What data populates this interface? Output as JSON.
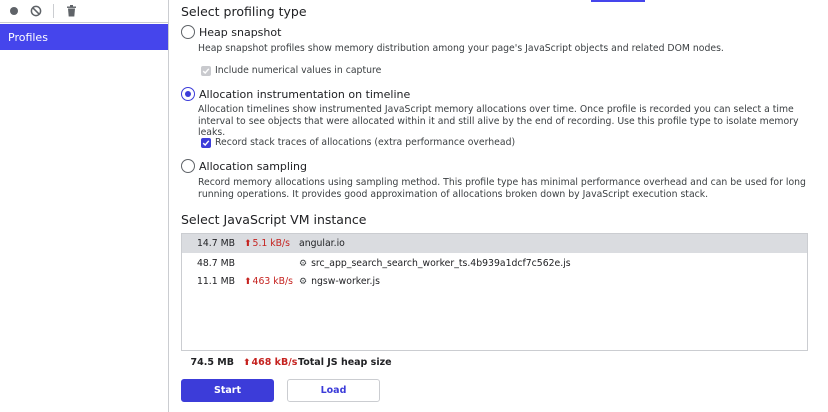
{
  "sidebar": {
    "toolbar": {
      "record_icon": "record-icon",
      "clear_icon": "clear-icon",
      "delete_icon": "trash-icon"
    },
    "items": [
      {
        "label": "Profiles",
        "selected": true
      }
    ]
  },
  "profiling_type": {
    "title": "Select profiling type",
    "options": [
      {
        "label": "Heap snapshot",
        "description": "Heap snapshot profiles show memory distribution among your page's JavaScript objects and related DOM nodes.",
        "checked": false,
        "sub_option": {
          "label": "Include numerical values in capture",
          "checked": true,
          "disabled": true
        }
      },
      {
        "label": "Allocation instrumentation on timeline",
        "description": "Allocation timelines show instrumented JavaScript memory allocations over time. Once profile is recorded you can select a time interval to see objects that were allocated within it and still alive by the end of recording. Use this profile type to isolate memory leaks.",
        "checked": true,
        "sub_option": {
          "label": "Record stack traces of allocations (extra performance overhead)",
          "checked": true,
          "disabled": false
        }
      },
      {
        "label": "Allocation sampling",
        "description": "Record memory allocations using sampling method. This profile type has minimal performance overhead and can be used for long running operations. It provides good approximation of allocations broken down by JavaScript execution stack.",
        "checked": false
      }
    ]
  },
  "vm": {
    "title": "Select JavaScript VM instance",
    "instances": [
      {
        "size": "14.7 MB",
        "rate": "5.1 kB/s",
        "name": "angular.io",
        "worker": false,
        "selected": true
      },
      {
        "size": "48.7 MB",
        "rate": "",
        "name": "src_app_search_search_worker_ts.4b939a1dcf7c562e.js",
        "worker": true,
        "selected": false
      },
      {
        "size": "11.1 MB",
        "rate": "463 kB/s",
        "name": "ngsw-worker.js",
        "worker": true,
        "selected": false
      }
    ],
    "total": {
      "size": "74.5 MB",
      "rate": "468 kB/s",
      "label": "Total JS heap size"
    }
  },
  "buttons": {
    "start": "Start",
    "load": "Load"
  },
  "colors": {
    "accent": "#3c3cd9",
    "sidebar_selected": "#4545ec",
    "rate_up": "#c5221f"
  }
}
